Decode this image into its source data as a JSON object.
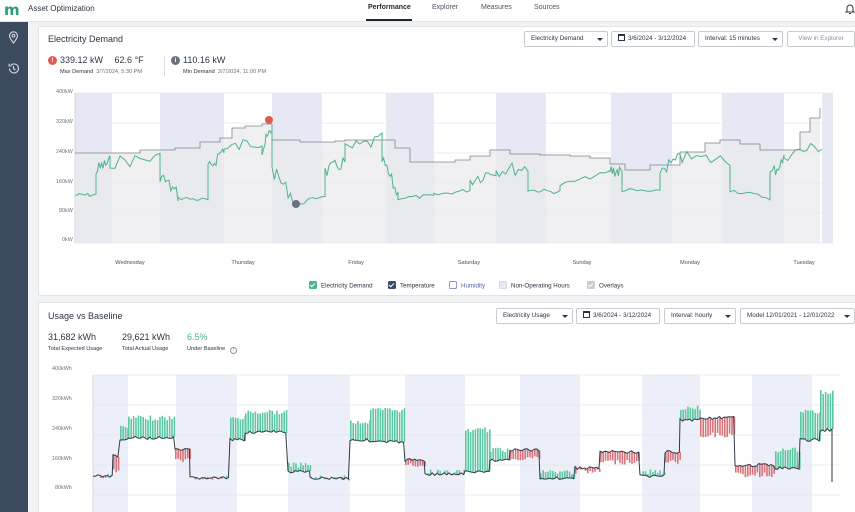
{
  "app": {
    "title": "Asset Optimization",
    "nav": [
      "Performance",
      "Explorer",
      "Measures",
      "Sources"
    ],
    "active_nav": "Performance"
  },
  "sidebar": {
    "icons": [
      "location-pin-icon",
      "history-icon"
    ]
  },
  "demand": {
    "title": "Electricity Demand",
    "controls": {
      "measure": "Electricity Demand",
      "date_range": "3/6/2024 - 3/12/2024",
      "interval": "Interval: 15 minutes",
      "view_button": "View in Explorer"
    },
    "max": {
      "value": "339.12 kW",
      "temp": "62.6 °F",
      "label": "Max Demand",
      "time": "3/7/2024, 5:30 PM"
    },
    "min": {
      "value": "110.16 kW",
      "label": "Min Demand",
      "time": "3/7/2024, 11:00 PM"
    },
    "yticks": [
      "400kW",
      "320kW",
      "240kW",
      "160kW",
      "80kW",
      "0kW"
    ],
    "days": [
      "Wednesday",
      "Thursday",
      "Friday",
      "Saturday",
      "Sunday",
      "Monday",
      "Tuesday"
    ],
    "legend": [
      "Electricity Demand",
      "Temperature",
      "Humidity",
      "Non-Operating Hours",
      "Overlays"
    ],
    "colors": {
      "demand": "#4fb389",
      "temperature": "#7c828c",
      "non_operating": "#e6e9f3",
      "max_badge": "#e05a4f",
      "min_badge": "#6a7280"
    }
  },
  "usage": {
    "title": "Usage vs Baseline",
    "controls": {
      "measure": "Electricity Usage",
      "date_range": "3/6/2024 - 3/12/2024",
      "interval": "Interval: hourly",
      "model": "Model 12/01/2021 - 12/01/2022"
    },
    "expected": {
      "value": "31,682 kWh",
      "label": "Total Expected Usage"
    },
    "actual": {
      "value": "29,621 kWh",
      "label": "Total Actual Usage"
    },
    "under": {
      "value": "6.5%",
      "label": "Under Baseline"
    },
    "yticks": [
      "400kWh",
      "320kWh",
      "240kWh",
      "160kWh",
      "80kWh"
    ],
    "colors": {
      "over": "#5cc7a1",
      "under": "#d9737b",
      "line": "#2f3a4a",
      "accent_text": "#4fb389"
    }
  }
}
